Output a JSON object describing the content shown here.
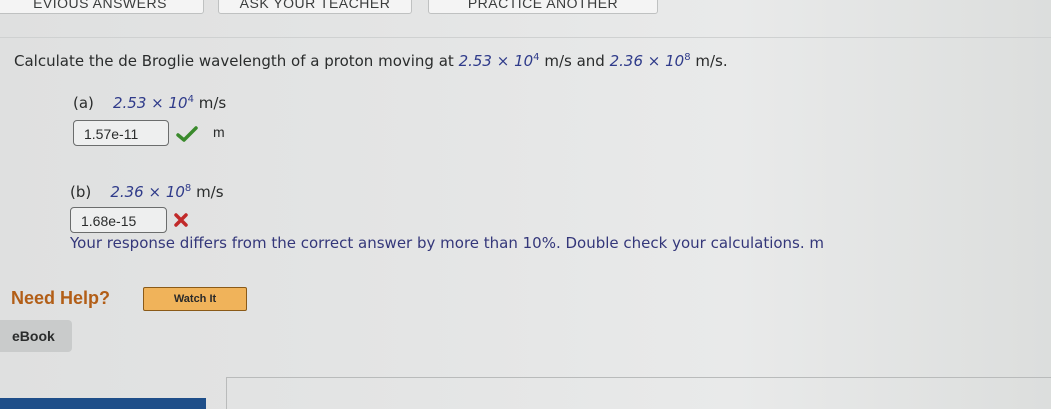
{
  "top_buttons": [
    {
      "label": "EVIOUS ANSWERS"
    },
    {
      "label": "ASK YOUR TEACHER"
    },
    {
      "label": "PRACTICE ANOTHER"
    }
  ],
  "question": {
    "prefix": "Calculate the de Broglie wavelength of a proton moving at",
    "v1_mantissa": "2.53 × 10",
    "v1_exp": "4",
    "v1_unit": "m/s",
    "connector": "and",
    "v2_mantissa": "2.36 × 10",
    "v2_exp": "8",
    "v2_unit": "m/s."
  },
  "part_a": {
    "label": "(a)",
    "mantissa": "2.53 × 10",
    "exp": "4",
    "unit": "m/s",
    "answer": "1.57e-11",
    "answer_unit": "m",
    "status": "correct"
  },
  "part_b": {
    "label": "(b)",
    "mantissa": "2.36 × 10",
    "exp": "8",
    "unit": "m/s",
    "answer": "1.68e-15",
    "status": "incorrect",
    "feedback": "Your response differs from the correct answer by more than 10%. Double check your calculations. m"
  },
  "help": {
    "title": "Need Help?",
    "watch_label": "Watch It"
  },
  "ebook_label": "eBook",
  "colors": {
    "correct": "#3a8a2c",
    "incorrect": "#c12a2a",
    "math": "#2f3b8a",
    "help_title": "#b25e17",
    "watch_button": "#f0b35a"
  }
}
